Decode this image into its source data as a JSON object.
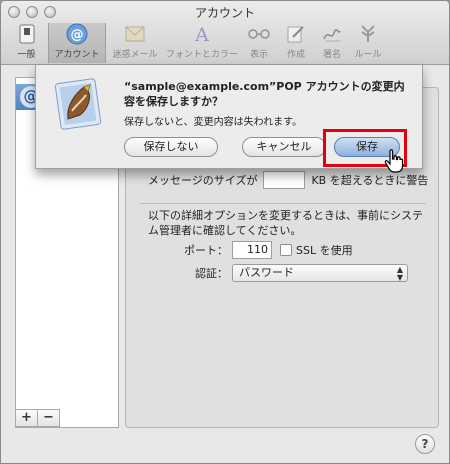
{
  "window": {
    "title": "アカウント"
  },
  "toolbar": {
    "items": [
      {
        "label": "一般",
        "icon": "switch-icon"
      },
      {
        "label": "アカウント",
        "icon": "at-icon"
      },
      {
        "label": "迷惑メール",
        "icon": "junk-mail-icon"
      },
      {
        "label": "フォントとカラー",
        "icon": "font-icon"
      },
      {
        "label": "表示",
        "icon": "glasses-icon"
      },
      {
        "label": "作成",
        "icon": "compose-icon"
      },
      {
        "label": "署名",
        "icon": "signature-icon"
      },
      {
        "label": "ルール",
        "icon": "rules-icon"
      }
    ]
  },
  "sidebar": {
    "add_label": "+",
    "remove_label": "−",
    "account_icon": "@"
  },
  "settings": {
    "size_label": "メッセージのサイズが",
    "size_value": "",
    "size_suffix": "KB を超えるときに警告",
    "advanced_note": "以下の詳細オプションを変更するときは、事前にシステム管理者に確認してください。",
    "port_label": "ポート：",
    "port_value": "110",
    "ssl_label": "SSL を使用",
    "auth_label": "認証：",
    "auth_value": "パスワード"
  },
  "dialog": {
    "title": "“sample@example.com”POP アカウントの変更内容を保存しますか？",
    "body": "保存しないと、変更内容は失われます。",
    "dont_save": "保存しない",
    "cancel": "キャンセル",
    "save": "保存"
  },
  "help_label": "?",
  "colors": {
    "highlight": "#e2000f",
    "default_button": "#8fb1dc"
  }
}
